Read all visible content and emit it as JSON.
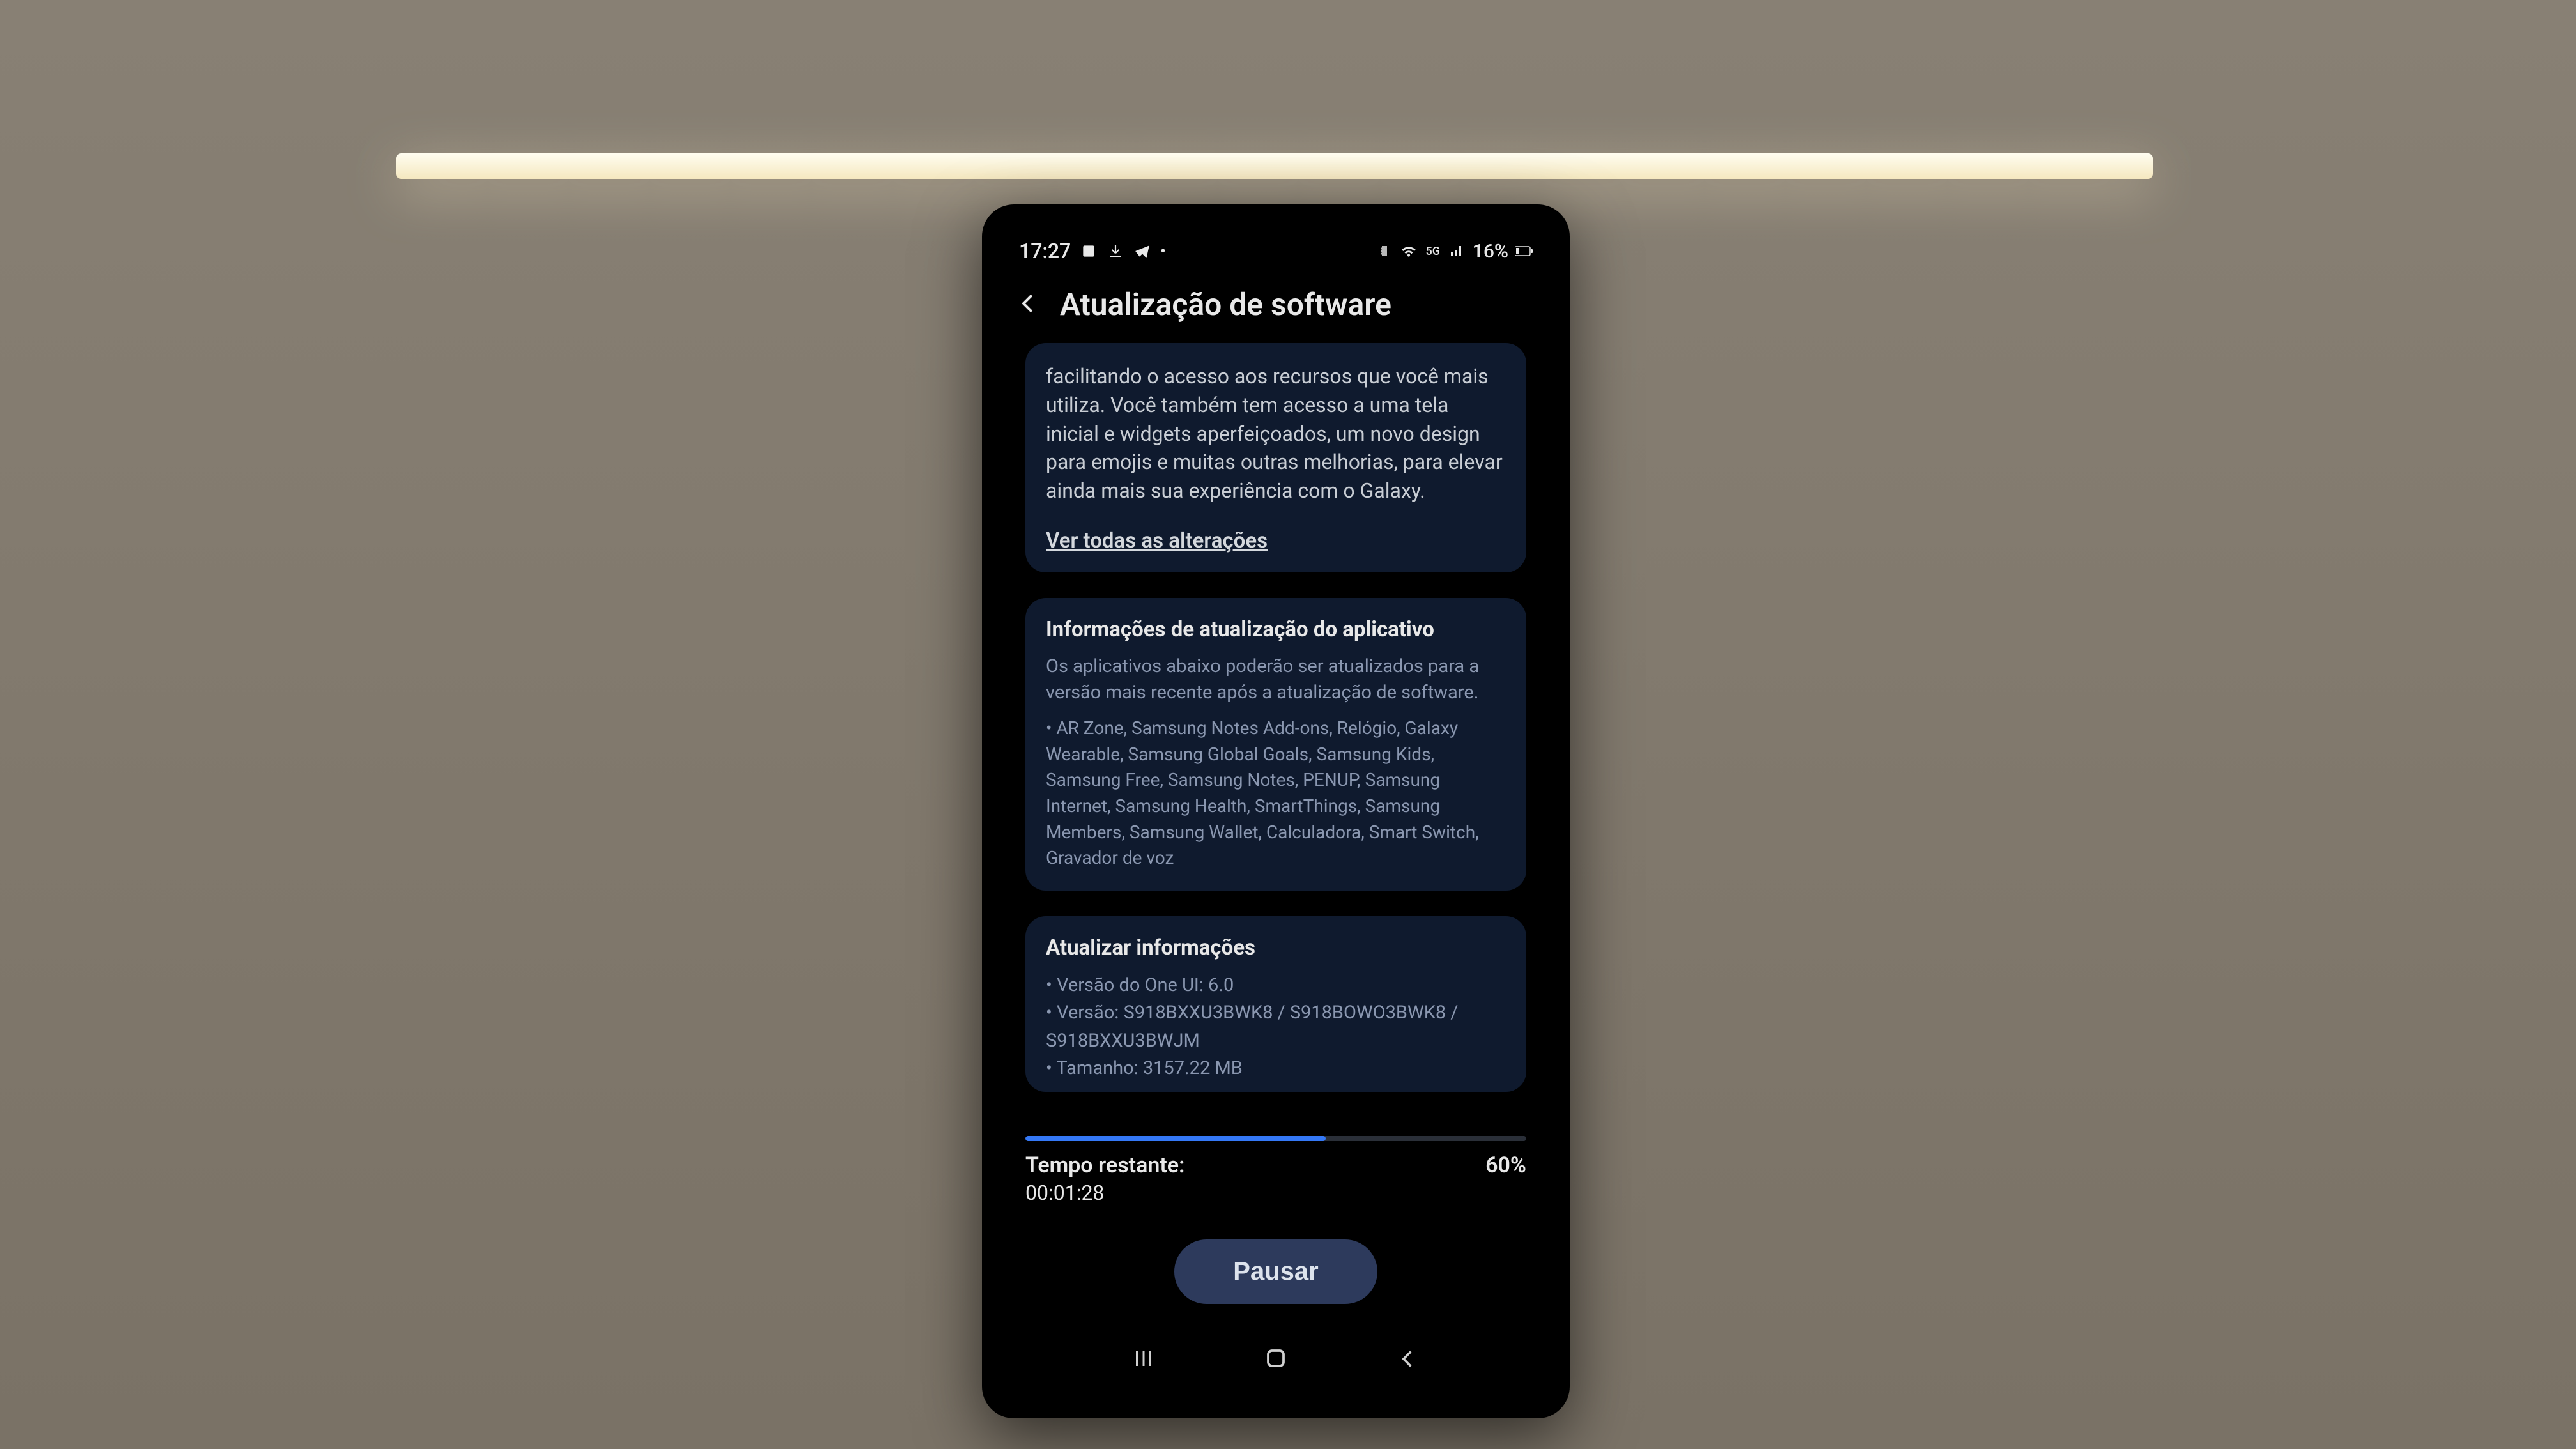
{
  "statusBar": {
    "time": "17:27",
    "battery": "16%"
  },
  "header": {
    "title": "Atualização de software"
  },
  "description": {
    "text": "facilitando o acesso aos recursos que você mais utiliza. Você também tem acesso a uma tela inicial e widgets aperfeiçoados, um novo design para emojis e muitas outras melhorias, para elevar ainda mais sua experiência com o Galaxy.",
    "link": "Ver todas as alterações"
  },
  "appInfo": {
    "heading": "Informações de atualização do aplicativo",
    "subtext": "Os aplicativos abaixo poderão ser atualizados para a versão mais recente após a atualização de software.",
    "apps": "• AR Zone, Samsung Notes Add-ons, Relógio, Galaxy Wearable, Samsung Global Goals, Samsung Kids, Samsung Free, Samsung Notes, PENUP, Samsung Internet, Samsung Health, SmartThings, Samsung Members, Samsung Wallet, Calculadora, Smart Switch, Gravador de voz"
  },
  "updateInfo": {
    "heading": "Atualizar informações",
    "line1": "• Versão do One UI: 6.0",
    "line2": "• Versão: S918BXXU3BWK8 / S918BOWO3BWK8 / S918BXXU3BWJM",
    "line3": "• Tamanho: 3157.22 MB"
  },
  "progress": {
    "percent": 60,
    "percentLabel": "60%",
    "timeLabel": "Tempo restante:",
    "timeValue": "00:01:28"
  },
  "buttons": {
    "pause": "Pausar"
  }
}
